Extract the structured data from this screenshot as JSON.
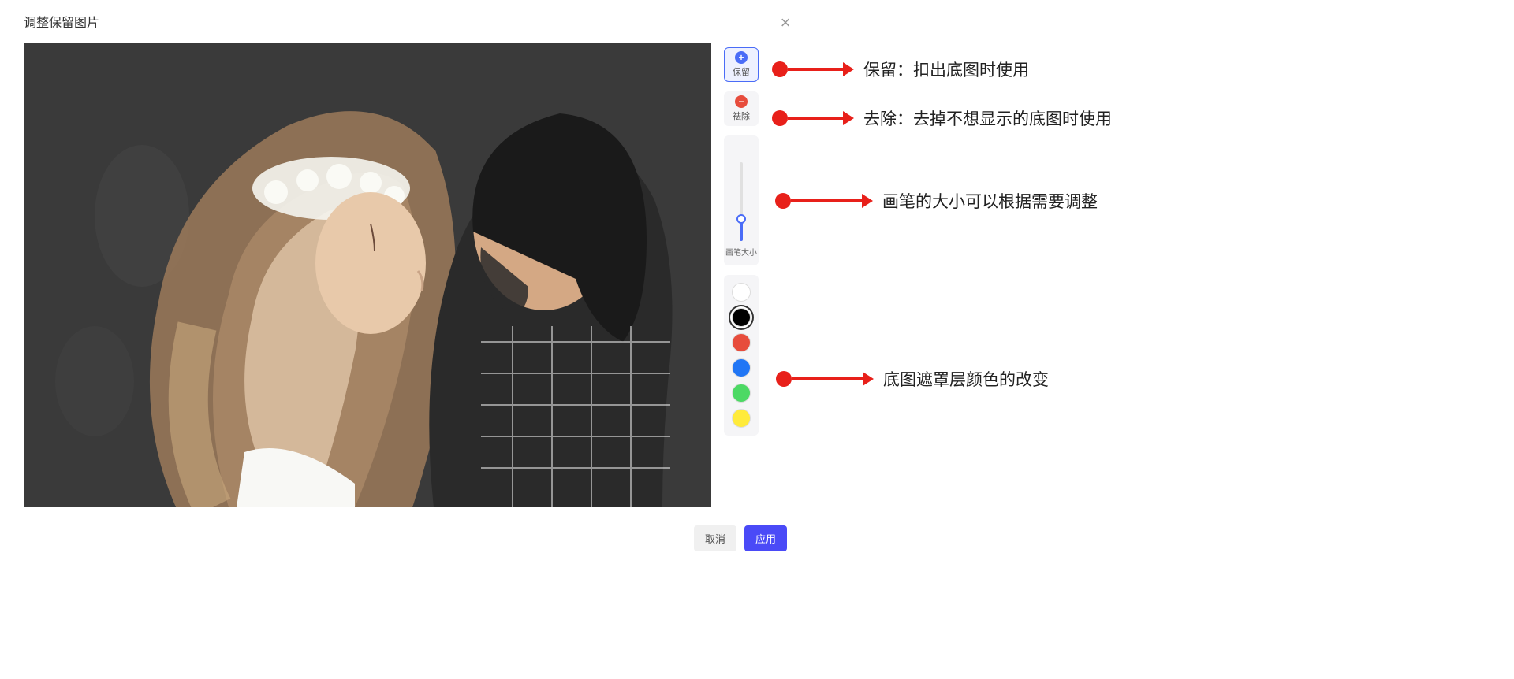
{
  "dialog": {
    "title": "调整保留图片"
  },
  "toolbar": {
    "keep_label": "保留",
    "remove_label": "祛除",
    "brush_label": "画笔大小"
  },
  "colors": {
    "white": "#ffffff",
    "black": "#000000",
    "red": "#e74c3c",
    "blue": "#2176f5",
    "green": "#4cd964",
    "yellow": "#ffeb3b",
    "selected": "black"
  },
  "footer": {
    "cancel_label": "取消",
    "apply_label": "应用"
  },
  "annotations": {
    "keep": "保留：扣出底图时使用",
    "remove": "去除：去掉不想显示的底图时使用",
    "brush": "画笔的大小可以根据需要调整",
    "colors": "底图遮罩层颜色的改变"
  }
}
